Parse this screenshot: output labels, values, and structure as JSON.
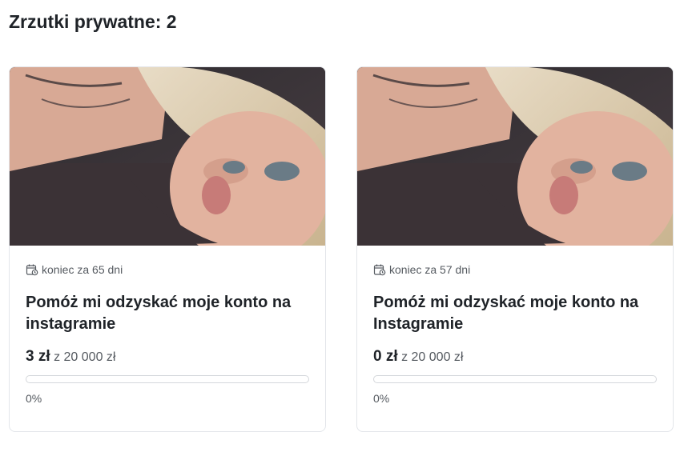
{
  "page": {
    "title": "Zrzutki prywatne: 2"
  },
  "cards": [
    {
      "image_alt": "photo",
      "deadline": "koniec za 65 dni",
      "title": "Pomóż mi odzyskać moje konto na instagramie",
      "raised": "3 zł",
      "goal": "z 20 000 zł",
      "progress_fraction": 0.0,
      "percent_label": "0%"
    },
    {
      "image_alt": "photo",
      "deadline": "koniec za 57 dni",
      "title": "Pomóż mi odzyskać moje konto na Instagramie",
      "raised": "0 zł",
      "goal": "z 20 000 zł",
      "progress_fraction": 0.0,
      "percent_label": "0%"
    }
  ],
  "icons": {
    "deadline": "calendar-clock-icon"
  },
  "colors": {
    "text": "#1f2328",
    "muted": "#555a60",
    "border": "#e3e6ea",
    "progress": "#2e9e5b"
  }
}
